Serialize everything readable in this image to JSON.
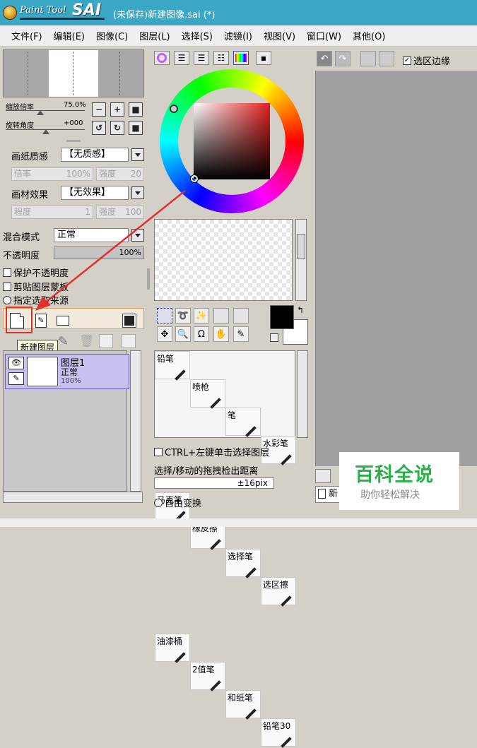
{
  "titlebar": {
    "logo_text": "Paint Tool",
    "logo_big": "SAI",
    "title": "(未保存)新建图像.sai (*)"
  },
  "menu": [
    "文件(F)",
    "编辑(E)",
    "图像(C)",
    "图层(L)",
    "选择(S)",
    "滤镜(I)",
    "视图(V)",
    "窗口(W)",
    "其他(O)"
  ],
  "navigator": {
    "zoom_label": "缩放倍率",
    "zoom_value": "75.0%",
    "rotate_label": "旋转角度",
    "rotate_value": "+000"
  },
  "paper": {
    "texture_label": "画纸质感",
    "texture_value": "【无质感】",
    "ratio_label": "倍率",
    "ratio_value": "100%",
    "strength_label": "强度",
    "strength_value": "20",
    "effect_label": "画材效果",
    "effect_value": "【无效果】",
    "degree_label": "程度",
    "degree_value": "1",
    "strength2_label": "强度",
    "strength2_value": "100"
  },
  "layer_props": {
    "blend_label": "混合模式",
    "blend_value": "正常",
    "opacity_label": "不透明度",
    "opacity_value": "100%",
    "opacity_level": 100,
    "protect_opacity": "保护不透明度",
    "clip_group": "剪贴图层蒙板",
    "selection_source": "指定选取来源"
  },
  "tooltip": "新建图层",
  "layer": {
    "name": "图层1",
    "mode": "正常",
    "opacity": "100%"
  },
  "brushes": [
    [
      "铅笔",
      "喷枪",
      "笔",
      "水彩笔"
    ],
    [
      "马克笔",
      "橡皮擦",
      "选择笔",
      "选区擦"
    ],
    [
      "油漆桶",
      "2值笔",
      "和纸笔",
      "铅笔30"
    ]
  ],
  "options": {
    "ctrl_click": "CTRL+左键单击选择图层",
    "drag_label": "选择/移动的拖拽检出距离",
    "drag_value": "±16pix",
    "free_transform": "自由变换"
  },
  "canvas_toolbar": {
    "selection_edge": "选区边缘"
  },
  "canvas_tab": "新",
  "watermark": {
    "title": "百科全说",
    "subtitle": "助你轻松解决"
  },
  "colors": {
    "title_bar": "#3aa8c4",
    "selected_layer": "#c9c0f0",
    "highlight": "#e03030",
    "primary_color": "#000000",
    "secondary_color": "#ffffff"
  }
}
